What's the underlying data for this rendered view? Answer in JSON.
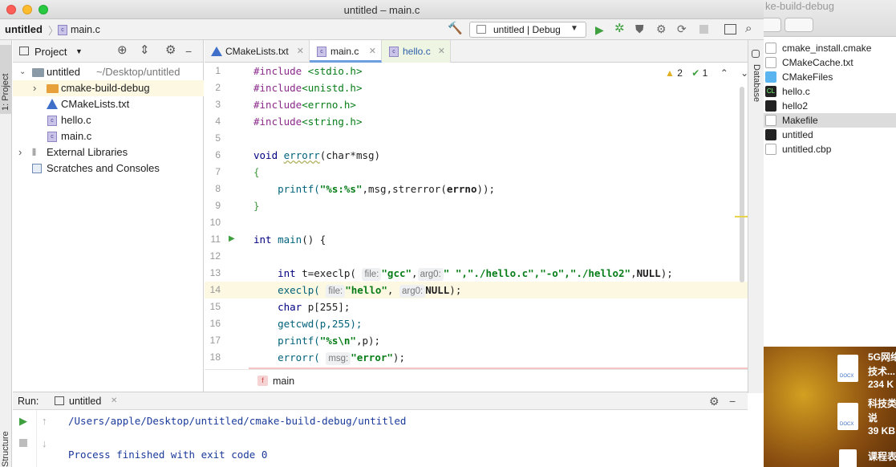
{
  "window": {
    "title": "untitled – main.c"
  },
  "navbar": {
    "crumb_project": "untitled",
    "crumb_file": "main.c",
    "run_config": "untitled | Debug"
  },
  "side_tabs": {
    "project": "1: Project",
    "database": "Database",
    "structure": "Structure"
  },
  "project_panel": {
    "title": "Project",
    "tree": [
      {
        "label": "untitled",
        "sub": "~/Desktop/untitled"
      },
      {
        "label": "cmake-build-debug"
      },
      {
        "label": "CMakeLists.txt"
      },
      {
        "label": "hello.c"
      },
      {
        "label": "main.c"
      },
      {
        "label": "External Libraries"
      },
      {
        "label": "Scratches and Consoles"
      }
    ]
  },
  "tabs": [
    {
      "label": "CMakeLists.txt"
    },
    {
      "label": "main.c"
    },
    {
      "label": "hello.c"
    }
  ],
  "inspections": {
    "warnings": "2",
    "ok": "1"
  },
  "code": {
    "line_numbers": [
      "1",
      "2",
      "3",
      "4",
      "5",
      "6",
      "7",
      "8",
      "9",
      "10",
      "11",
      "12",
      "13",
      "14",
      "15",
      "16",
      "17",
      "18"
    ],
    "lines": {
      "l1a": "#include ",
      "l1b": "<stdio.h>",
      "l2a": "#include",
      "l2b": "<unistd.h>",
      "l3a": "#include",
      "l3b": "<errno.h>",
      "l4a": "#include",
      "l4b": "<string.h>",
      "l6a": "void ",
      "l6b": "errorr",
      "l6c": "(char*msg)",
      "l7": "{",
      "l8a": "    printf(",
      "l8b": "\"%s:%s\"",
      "l8c": ",msg,strerror(",
      "l8d": "errno",
      "l8e": "));",
      "l9": "}",
      "l11a": "int ",
      "l11b": "main",
      "l11c": "() {",
      "l13a": "    int ",
      "l13b": "t=execlp( ",
      "l13h1": "file:",
      "l13s1": "\"gcc\"",
      "l13c": ",",
      "l13h2": "arg0:",
      "l13s2": "\" \",\"./hello.c\",\"-o\",\"./hello2\"",
      "l13d": ",",
      "l13e": "NULL",
      "l13f": ");",
      "l14a": "    execlp( ",
      "l14h1": "file:",
      "l14s1": "\"hello\"",
      "l14c": ", ",
      "l14h2": "arg0:",
      "l14e": "NULL",
      "l14f": ");",
      "l15a": "    char ",
      "l15b": "p[255];",
      "l16a": "    getcwd(p,255);",
      "l17a": "    printf(",
      "l17s": "\"%s\\n\"",
      "l17b": ",p);",
      "l18a": "    errorr( ",
      "l18h": "msg:",
      "l18s": "\"error\"",
      "l18b": ");"
    }
  },
  "breadcrumb_func": "main",
  "run_panel": {
    "label": "Run:",
    "tab": "untitled",
    "output_path": "/Users/apple/Desktop/untitled/cmake-build-debug/untitled",
    "output_exit": "Process finished with exit code 0"
  },
  "finder": {
    "path_title": "ke-build-debug",
    "files": [
      {
        "name": "cmake_install.cmake"
      },
      {
        "name": "CMakeCache.txt"
      },
      {
        "name": "CMakeFiles"
      },
      {
        "name": "hello.c"
      },
      {
        "name": "hello2"
      },
      {
        "name": "Makefile"
      },
      {
        "name": "untitled"
      },
      {
        "name": "untitled.cbp"
      }
    ]
  },
  "desktop": {
    "item1": {
      "name": "5G网络",
      "name2": "技术...",
      "size": "234 K"
    },
    "item2": {
      "name": "科技类",
      "name2": "说",
      "size": "39 KB"
    },
    "item3": {
      "name": "课程表"
    },
    "docx": "DOCX"
  },
  "colors": {
    "accent": "#3875d7",
    "highlight": "#fcf8e1",
    "run_green": "#3ea03e"
  }
}
